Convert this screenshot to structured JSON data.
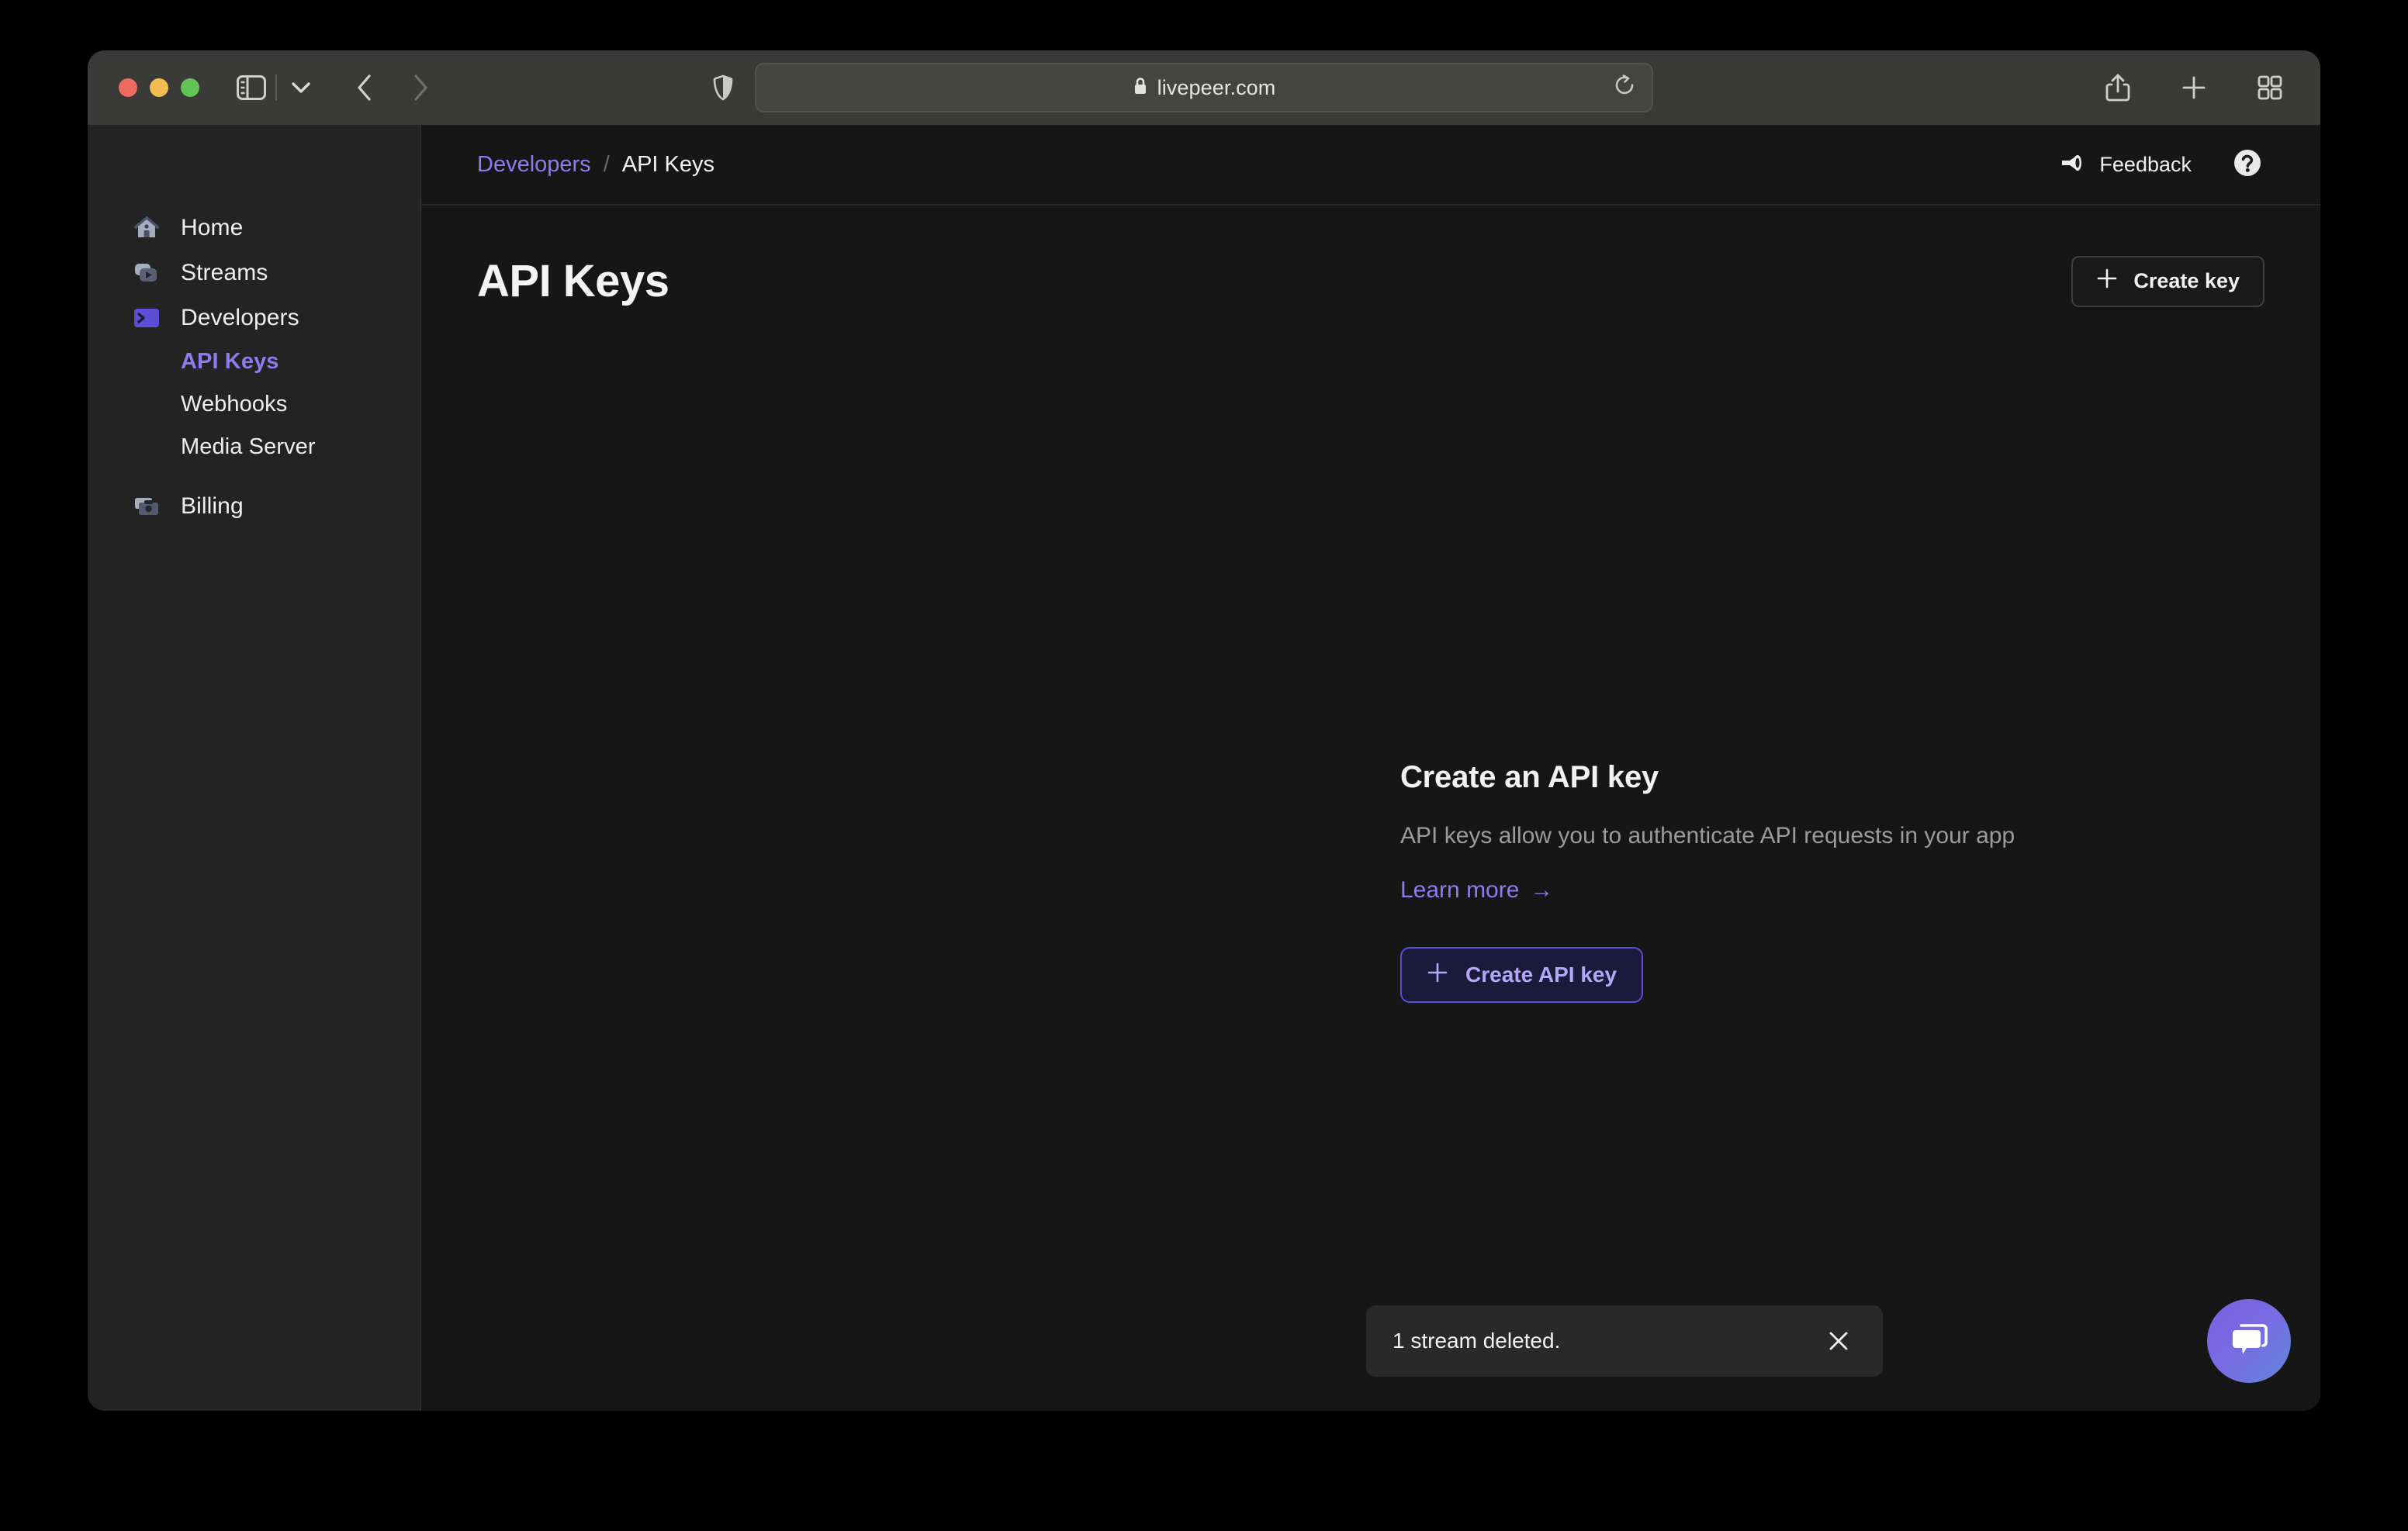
{
  "browser": {
    "url": "livepeer.com",
    "lock_icon": "lock-icon",
    "traffic_lights": [
      "close-button",
      "minimize-button",
      "maximize-button"
    ],
    "sidebar_toggle_icon": "sidebar-toggle-icon",
    "sidebar_dropdown_icon": "chevron-down-icon",
    "back_icon": "chevron-left-icon",
    "forward_icon": "chevron-right-icon",
    "shield_icon": "shield-icon",
    "notion_icon": "notion-extension-icon",
    "reload_icon": "reload-icon",
    "share_icon": "share-icon",
    "new_tab_icon": "plus-icon",
    "tab_overview_icon": "tab-overview-icon"
  },
  "sidebar": {
    "items": [
      {
        "label": "Home",
        "icon": "home-icon",
        "type": "top",
        "active": false
      },
      {
        "label": "Streams",
        "icon": "streams-icon",
        "type": "top",
        "active": false
      },
      {
        "label": "Developers",
        "icon": "developers-terminal-icon",
        "type": "top",
        "active": false
      },
      {
        "label": "API Keys",
        "icon": "",
        "type": "sub",
        "active": true
      },
      {
        "label": "Webhooks",
        "icon": "",
        "type": "sub",
        "active": false
      },
      {
        "label": "Media Server",
        "icon": "",
        "type": "sub",
        "active": false
      },
      {
        "label": "Billing",
        "icon": "billing-wallet-icon",
        "type": "top",
        "active": false
      }
    ]
  },
  "topbar": {
    "breadcrumb": {
      "parent": "Developers",
      "separator": "/",
      "current": "API Keys"
    },
    "feedback_label": "Feedback",
    "feedback_icon": "megaphone-icon",
    "help_icon": "help-circle-icon"
  },
  "main": {
    "page_title": "API Keys",
    "create_key_label": "Create key",
    "create_key_icon": "plus-icon",
    "empty_state": {
      "title": "Create an API key",
      "description": "API keys allow you to authenticate API requests in your app",
      "learn_more_label": "Learn more",
      "learn_more_arrow": "→",
      "button_label": "Create API key",
      "button_icon": "plus-icon"
    }
  },
  "toast": {
    "message": "1 stream deleted.",
    "close_icon": "close-icon"
  },
  "chat": {
    "icon": "chat-bubble-icon"
  },
  "colors": {
    "accent_purple": "#8c7cf0",
    "accent_purple_strong": "#5b4fd6",
    "window_chrome": "#3a3a38",
    "sidebar_bg": "#232323",
    "main_bg": "#161616",
    "toast_bg": "#292929"
  }
}
